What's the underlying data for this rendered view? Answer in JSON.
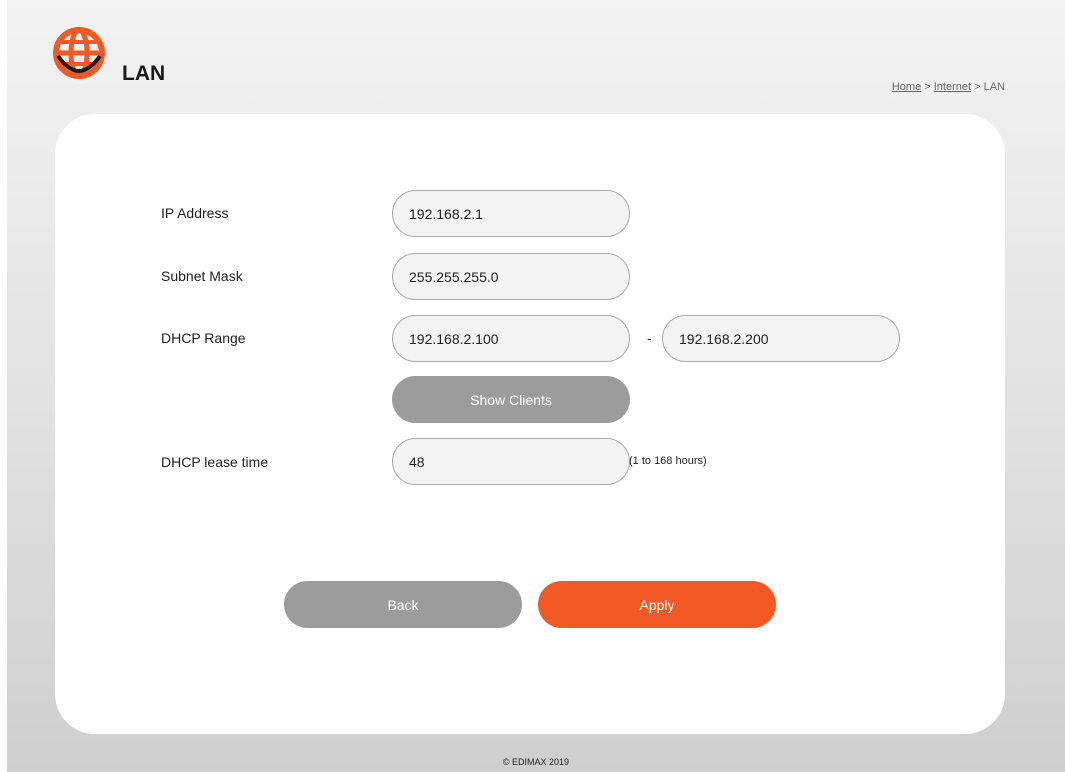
{
  "header": {
    "logo_icon": "globe-icon",
    "accent_color": "#f15a24",
    "title": "LAN",
    "breadcrumb": {
      "home": "Home",
      "sep1": " > ",
      "internet": "Internet",
      "sep2": " > ",
      "current": "LAN"
    }
  },
  "form": {
    "ip_address": {
      "label": "IP Address",
      "value": "192.168.2.1"
    },
    "subnet_mask": {
      "label": "Subnet Mask",
      "value": "255.255.255.0"
    },
    "dhcp_range": {
      "label": "DHCP Range",
      "start": "192.168.2.100",
      "separator": "-",
      "end": "192.168.2.200"
    },
    "show_clients_label": "Show Clients",
    "lease_time": {
      "label": "DHCP lease time",
      "value": "48",
      "hint": "(1 to 168 hours)"
    }
  },
  "actions": {
    "back_label": "Back",
    "apply_label": "Apply"
  },
  "footer": {
    "copyright": "© EDIMAX 2019"
  }
}
